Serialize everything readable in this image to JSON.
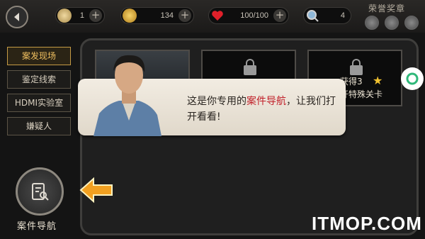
{
  "topbar": {
    "stats": [
      {
        "icon": "key-icon",
        "value": "1"
      },
      {
        "icon": "coin-icon",
        "value": "134"
      },
      {
        "icon": "heart-icon",
        "value": "100/100"
      },
      {
        "icon": "magnifier-icon",
        "value": "4"
      }
    ],
    "honor_title": "荣誉奖章"
  },
  "tabs": [
    {
      "label": "案发现场",
      "active": true
    },
    {
      "label": "鉴定线索",
      "active": false
    },
    {
      "label": "HDMI实验室",
      "active": false
    },
    {
      "label": "嫌疑人",
      "active": false
    }
  ],
  "slots": {
    "third_text_line1": "获得3",
    "third_text_line2": "开特殊关卡"
  },
  "dialog": {
    "text_before": "这是你专用的",
    "highlight": "案件导航",
    "text_after": "，让我们打开看看!"
  },
  "guide": {
    "label": "案件导航"
  },
  "watermark": "ITMOP.COM",
  "colors": {
    "accent_gold": "#c59b45",
    "highlight_red": "#c1202a",
    "arrow_orange": "#f2a020"
  }
}
